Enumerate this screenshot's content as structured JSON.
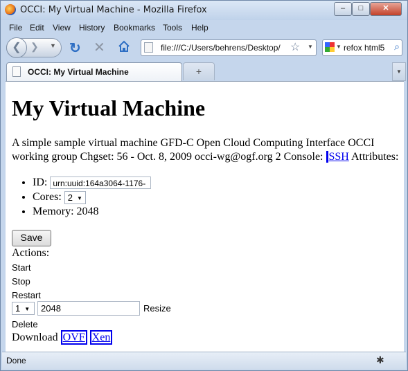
{
  "window": {
    "title": "OCCI: My Virtual Machine - Mozilla Firefox"
  },
  "menu": [
    "File",
    "Edit",
    "View",
    "History",
    "Bookmarks",
    "Tools",
    "Help"
  ],
  "navbar": {
    "url": "file:///C:/Users/behrens/Desktop/",
    "search_text": "refox html5"
  },
  "tab": {
    "label": "OCCI: My Virtual Machine",
    "newtab": "+"
  },
  "page": {
    "heading": "My Virtual Machine",
    "description": "A simple sample virtual machine GFD-C Open Cloud Computing Interface OCCI working group Chgset: 56 - Oct. 8, 2009 occi-wg@ogf.org 2 Console:",
    "console_link": "SSH",
    "attributes_label": "Attributes:",
    "id_label": "ID:",
    "id_value": "urn:uuid:164a3064-1176-",
    "cores_label": "Cores:",
    "cores_value": "2",
    "memory_label": "Memory:",
    "memory_value": "2048",
    "save_label": "Save",
    "actions_label": "Actions:",
    "actions": {
      "start": "Start",
      "stop": "Stop",
      "restart": "Restart",
      "delete": "Delete"
    },
    "resize_select": "1",
    "resize_value": "2048",
    "resize_label": "Resize",
    "download_label": "Download",
    "download_links": {
      "ovf": "OVF",
      "xen": "Xen"
    }
  },
  "status": "Done"
}
